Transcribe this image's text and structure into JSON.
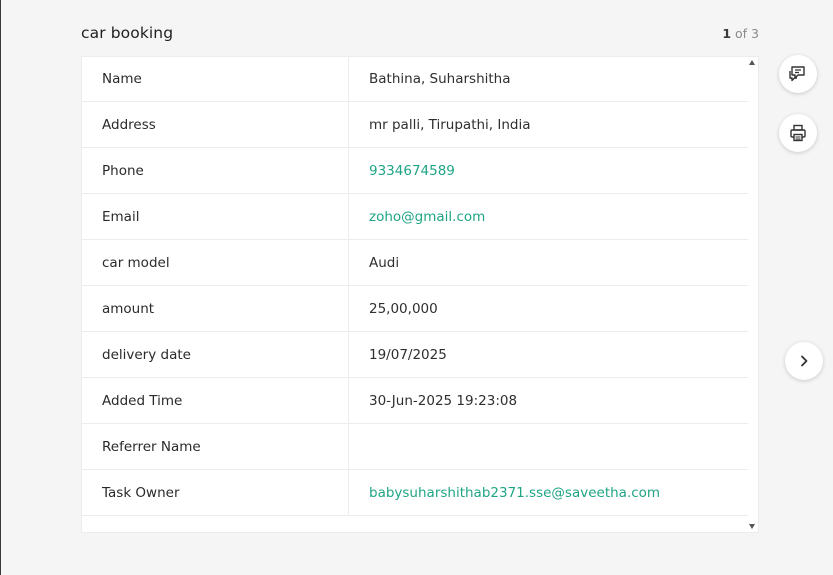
{
  "header": {
    "title": "car booking",
    "pager_current": "1",
    "pager_of": "of 3"
  },
  "record": {
    "rows": [
      {
        "label": "Name",
        "value": "Bathina, Suharshitha"
      },
      {
        "label": "Address",
        "value": "mr palli, Tirupathi, India"
      },
      {
        "label": "Phone",
        "value": "9334674589"
      },
      {
        "label": "Email",
        "value": "zoho@gmail.com"
      },
      {
        "label": "car model",
        "value": "Audi"
      },
      {
        "label": "amount",
        "value": "25,00,000"
      },
      {
        "label": "delivery date",
        "value": "19/07/2025"
      },
      {
        "label": "Added Time",
        "value": "30-Jun-2025 19:23:08"
      },
      {
        "label": "Referrer Name",
        "value": ""
      },
      {
        "label": "Task Owner",
        "value": "babysuharshithab2371.sse@saveetha.com"
      }
    ]
  },
  "icons": {
    "comment": "comment-icon",
    "print": "print-icon",
    "next": "chevron-right-icon"
  },
  "colors": {
    "link": "#1fa585",
    "background": "#f5f5f5",
    "card": "#ffffff"
  }
}
